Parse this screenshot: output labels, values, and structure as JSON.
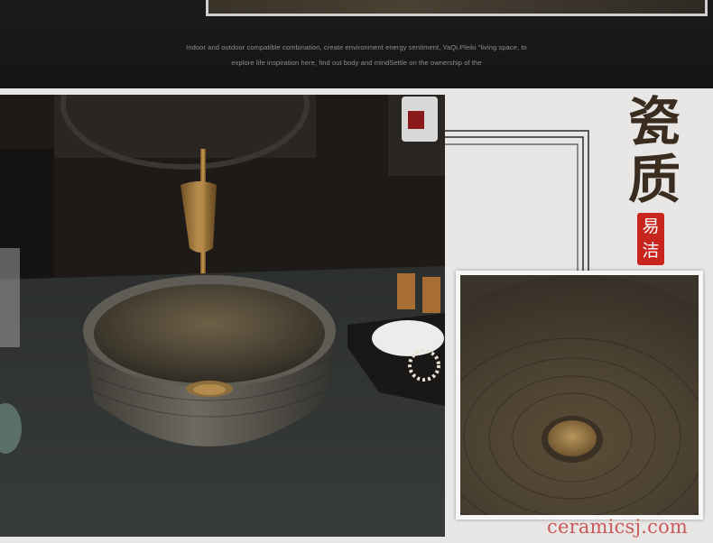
{
  "banner": {
    "line1": "Indoor and outdoor compatible combination, create environment  energy sentiment, YaQi.Pleiki \"living space, to",
    "line2": "explore life inspiration here, find out body and mindSettle on the ownership of the"
  },
  "title": {
    "char1": "瓷",
    "char2": "质",
    "seal_line1": "易",
    "seal_line2": "洁"
  },
  "watermark": "ceramicsj.com",
  "colors": {
    "banner_bg": "#1b1b1b",
    "title": "#3b2c20",
    "seal": "#c8251f",
    "watermark": "#c74d4d"
  }
}
